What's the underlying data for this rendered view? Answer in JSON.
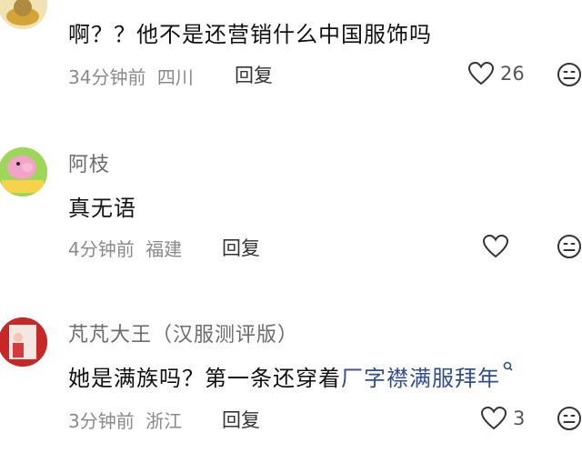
{
  "comments": [
    {
      "username": "",
      "text": "啊？？他不是还营销什么中国服饰吗",
      "time": "34分钟前",
      "location": "四川",
      "reply_label": "回复",
      "like_count": "26",
      "avatar_colors": [
        "#e9c46a",
        "#b08a3e"
      ]
    },
    {
      "username": "阿枝",
      "text": "真无语",
      "time": "4分钟前",
      "location": "福建",
      "reply_label": "回复",
      "like_count": "",
      "avatar_colors": [
        "#8fd14f",
        "#f3a3c8"
      ]
    },
    {
      "username": "芃芃大王（汉服测评版）",
      "text": "她是满族吗？第一条还穿着",
      "text_link": "厂字襟满服拜年",
      "time": "3分钟前",
      "location": "浙江",
      "reply_label": "回复",
      "like_count": "3",
      "avatar_colors": [
        "#c62828",
        "#f5f5f5"
      ]
    }
  ],
  "icons": {
    "like": "heart-outline-icon",
    "dislike": "neutral-face-icon",
    "link": "search-small-icon"
  },
  "colors": {
    "text": "#111111",
    "meta": "#8a8a8a",
    "link": "#2f4f8f"
  }
}
